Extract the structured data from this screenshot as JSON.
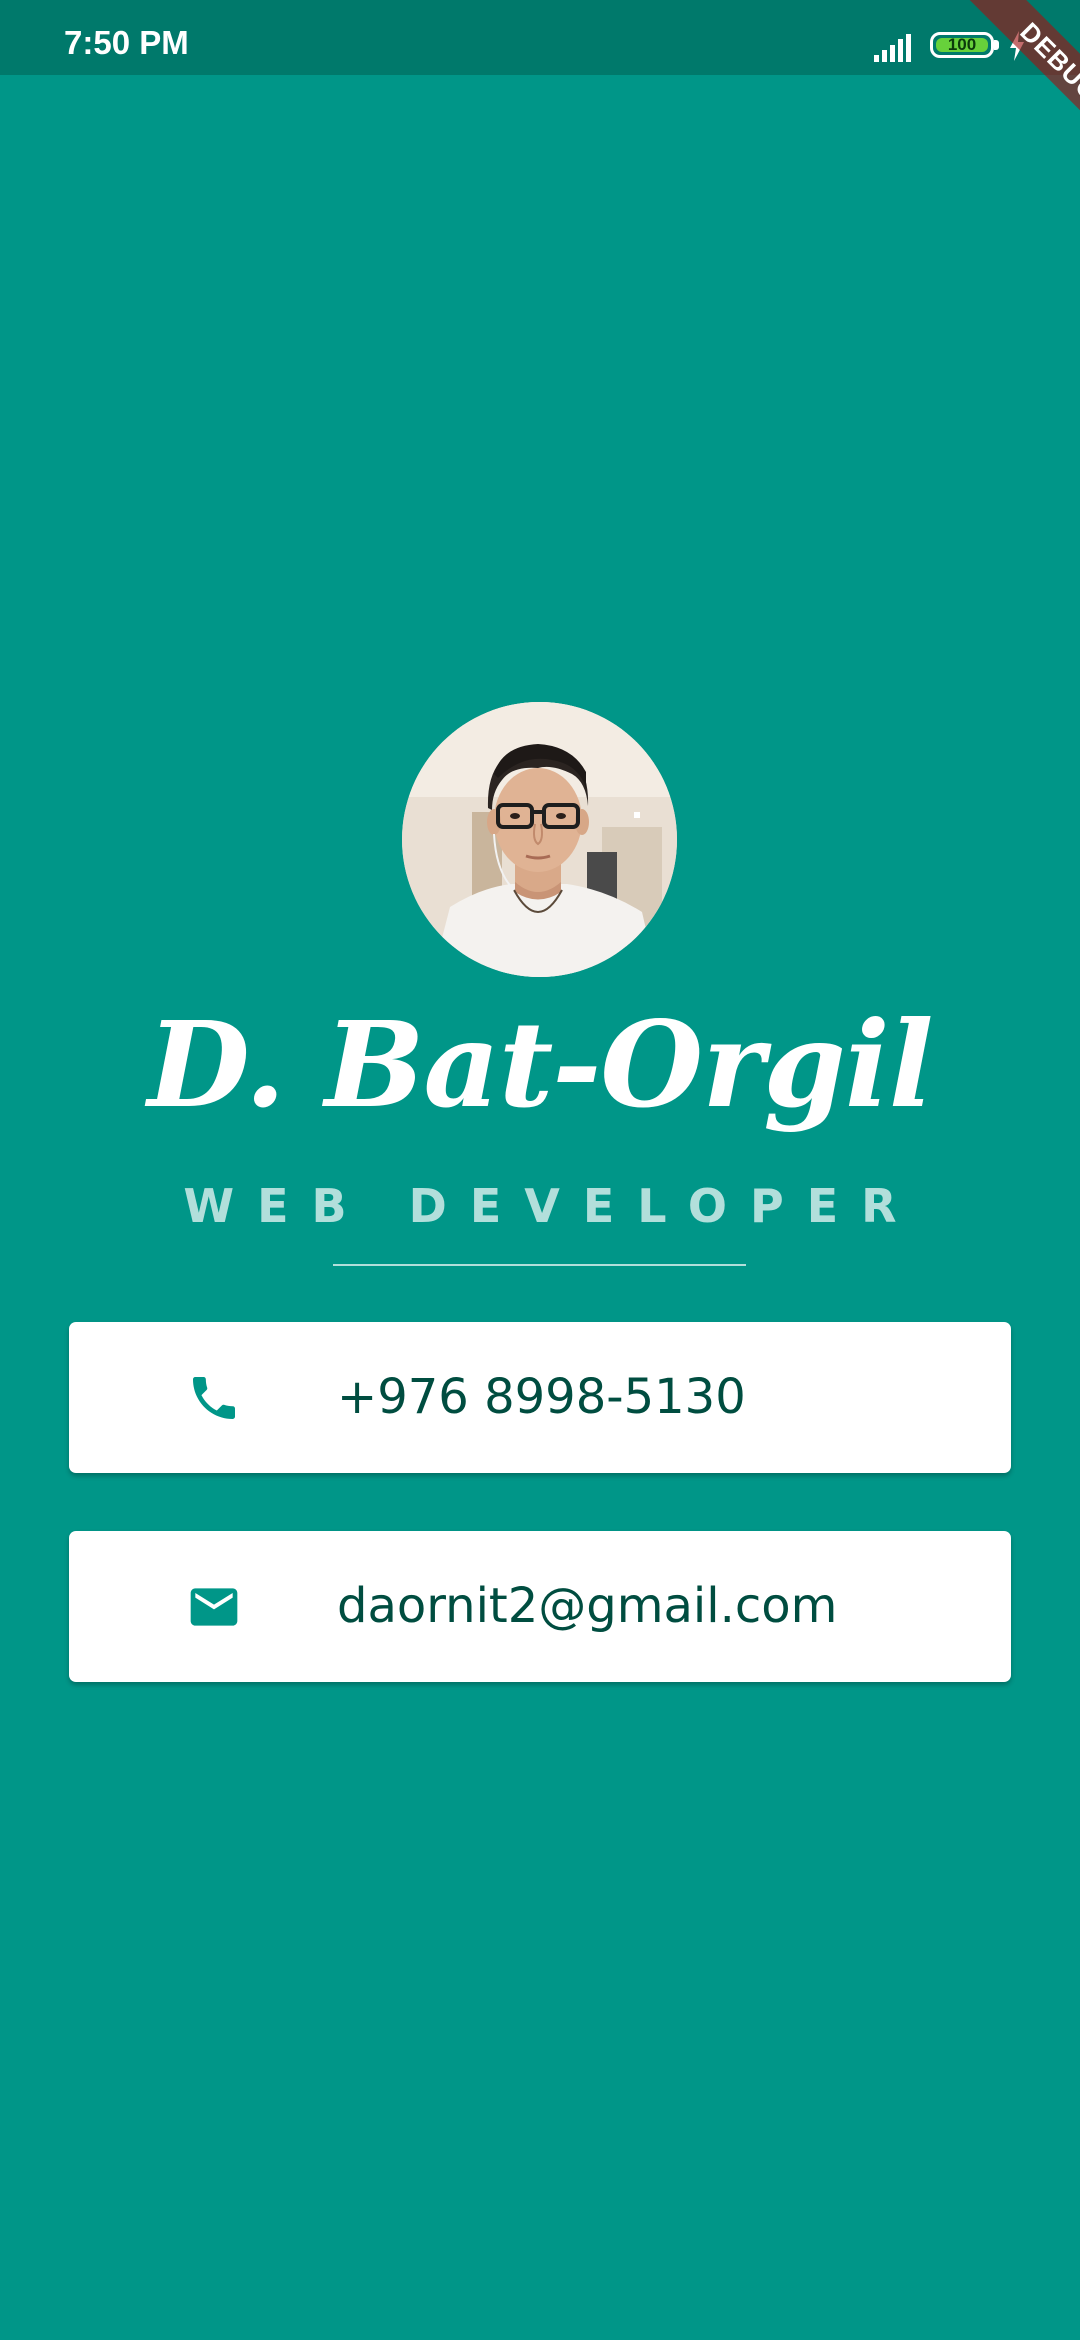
{
  "status_bar": {
    "time": "7:50 PM",
    "battery_level": "100",
    "icons": [
      "signal-icon",
      "battery-icon",
      "charge-icon"
    ]
  },
  "debug_banner": {
    "label": "DEBUG"
  },
  "profile": {
    "avatar": "profile-photo",
    "name": "D. Bat-Orgil",
    "title": "WEB DEVELOPER"
  },
  "contacts": [
    {
      "icon": "phone-icon",
      "value": "+976 8998-5130"
    },
    {
      "icon": "email-icon",
      "value": "daornit2@gmail.com"
    }
  ],
  "colors": {
    "background": "#009688",
    "status_bar": "#00796b",
    "title_text": "#b2dfdb",
    "card_text": "#004d40",
    "card_icon": "#009688",
    "card_background": "#ffffff",
    "debug_ribbon": "#a01414"
  }
}
